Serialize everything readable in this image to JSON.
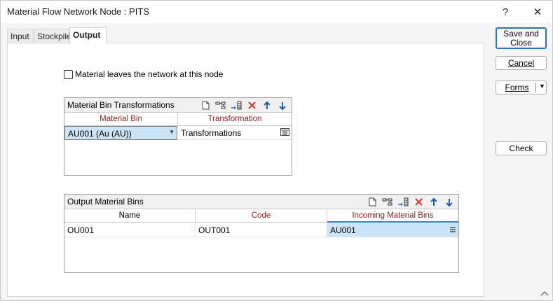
{
  "window": {
    "title": "Material Flow Network Node : PITS",
    "help_label": "?",
    "close_label": "✕"
  },
  "tabs": [
    {
      "label": "Input"
    },
    {
      "label": "Stockpile"
    },
    {
      "label": "Output"
    }
  ],
  "output": {
    "leaves_checkbox": {
      "label": "Material leaves the network at this node",
      "checked": false
    },
    "transformations": {
      "title": "Material Bin Transformations",
      "columns": [
        "Material Bin",
        "Transformation"
      ],
      "rows": [
        {
          "material_bin": "AU001 (Au (AU))",
          "transformation": "Transformations"
        }
      ]
    },
    "output_bins": {
      "title": "Output Material Bins",
      "columns": [
        "Name",
        "Code",
        "Incoming Material Bins"
      ],
      "rows": [
        {
          "name": "OU001",
          "code": "OUT001",
          "incoming": "AU001"
        }
      ]
    }
  },
  "buttons": {
    "save_close": "Save and Close",
    "cancel": "Cancel",
    "forms": "Forms",
    "check": "Check"
  },
  "colors": {
    "accent": "#2b72c0",
    "selection": "#cce4f7",
    "required_header": "#8b1a1a",
    "delete": "#d9342b",
    "arrows": "#1f5fa8"
  }
}
